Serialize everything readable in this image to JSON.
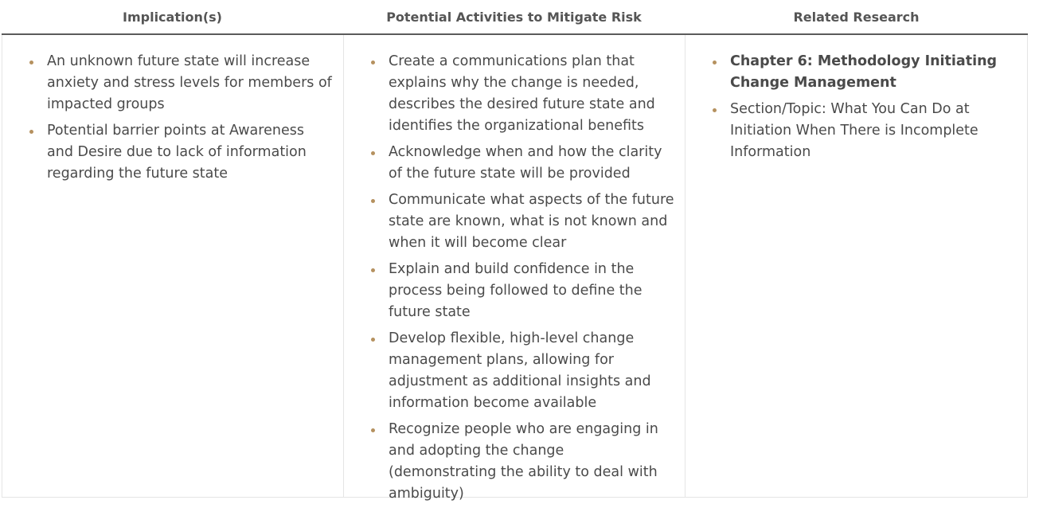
{
  "table": {
    "headers": [
      "Implication(s)",
      "Potential Activities to Mitigate Risk",
      "Related Research"
    ],
    "implications": [
      "An unknown future state will increase anxiety and stress levels for members of impacted groups",
      "Potential barrier points at Awareness and Desire due to lack of information regarding the future state"
    ],
    "activities": [
      "Create a communications plan that explains why the change is needed, describes the desired future state and identifies the organizational benefits",
      "Acknowledge when and how the clarity of the future state will be provided",
      "Communicate what aspects of the future state are known, what is not known and when it will become clear",
      "Explain and build confidence in the process being followed to define the future state",
      "Develop flexible, high-level change management plans, allowing for adjustment as additional insights and information become available",
      "Recognize people who are engaging in and adopting the change (demonstrating the ability to deal with ambiguity)"
    ],
    "research": [
      "Chapter 6: Methodology Initiating Change Management",
      "Section/Topic: What You Can Do at Initiation When There is Incomplete Information"
    ]
  },
  "colors": {
    "bullet": "#b5915f",
    "header_rule": "#5b5b5b",
    "grid": "#e5e5e5",
    "text": "#4a4a4a"
  }
}
